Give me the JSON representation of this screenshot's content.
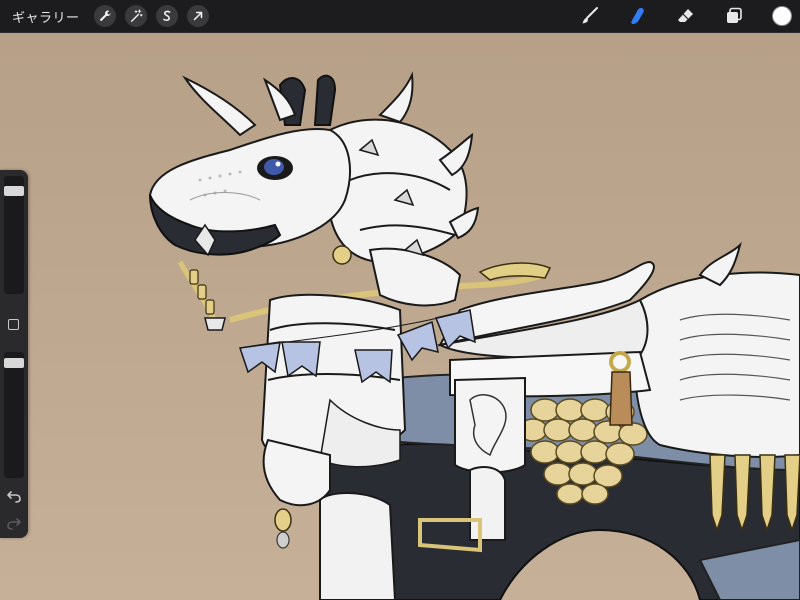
{
  "toolbar": {
    "gallery_label": "ギャラリー",
    "left_tools": [
      {
        "name": "actions",
        "icon": "wrench-icon"
      },
      {
        "name": "adjustments",
        "icon": "magic-wand-icon"
      },
      {
        "name": "selection",
        "icon": "selection-s-icon"
      },
      {
        "name": "transform",
        "icon": "arrow-cursor-icon"
      }
    ],
    "right_tools": [
      {
        "name": "brush",
        "icon": "brush-icon",
        "active": false
      },
      {
        "name": "smudge",
        "icon": "smudge-finger-icon",
        "active": true
      },
      {
        "name": "eraser",
        "icon": "eraser-icon",
        "active": false
      },
      {
        "name": "layers",
        "icon": "layers-icon",
        "active": false
      }
    ],
    "current_color": "#ffffff",
    "active_color": "#2f7cf6"
  },
  "sidebar": {
    "brush_size": 0.95,
    "opacity": 0.95
  },
  "canvas": {
    "background_color": "#bfa88f",
    "artwork": "armored-horse-illustration"
  }
}
